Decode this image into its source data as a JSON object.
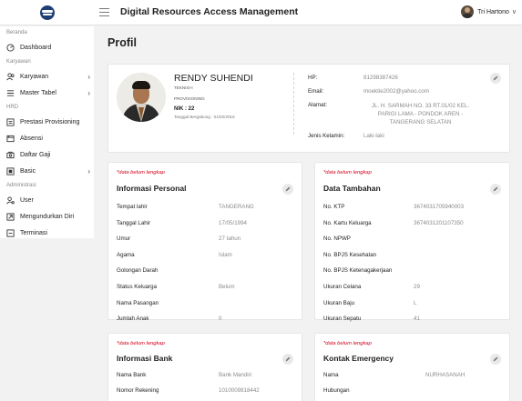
{
  "app": {
    "title": "Digital Resources Access Management"
  },
  "user": {
    "name": "Tri Hartono"
  },
  "sidebar": {
    "sections": [
      {
        "label": "Beranda"
      },
      {
        "label": "Karyawan"
      },
      {
        "label": "HRD"
      },
      {
        "label": "Administrasi"
      }
    ],
    "items": [
      {
        "label": "Dashboard",
        "icon": "dashboard-icon"
      },
      {
        "label": "Karyawan",
        "icon": "people-icon",
        "chevron": "›"
      },
      {
        "label": "Master Tabel",
        "icon": "table-icon",
        "chevron": "›"
      },
      {
        "label": "Prestasi Provisioning",
        "icon": "document-icon"
      },
      {
        "label": "Absensi",
        "icon": "absence-icon"
      },
      {
        "label": "Daftar Gaji",
        "icon": "salary-icon"
      },
      {
        "label": "Basic",
        "icon": "basic-icon",
        "chevron": "›"
      },
      {
        "label": "User",
        "icon": "user-gear-icon"
      },
      {
        "label": "Mengundurkan Diri",
        "icon": "resign-icon"
      },
      {
        "label": "Terminasi",
        "icon": "terminate-icon"
      }
    ]
  },
  "page": {
    "title": "Profil"
  },
  "profile": {
    "name": "RENDY SUHENDI",
    "role": "TEKNISI-I",
    "department": "PROVISIONING",
    "nik": "NIK : 22",
    "joined": "Tanggal Bergabung : 01/02/2016",
    "contact": [
      {
        "label": "HP:",
        "value": "81298387426"
      },
      {
        "label": "Email:",
        "value": "moektie2002@yahoo.com"
      },
      {
        "label": "Alamat:",
        "value": "JL. H. SARMAH NO. 33 RT.01/02 KEL. PARIGI LAMA - PONDOK AREN - TANGERANG SELATAN"
      },
      {
        "label": "Jenis Kelamin:",
        "value": "Laki-laki"
      }
    ]
  },
  "cards": {
    "incomplete_note": "*data belum lengkap",
    "personal": {
      "title": "Informasi Personal",
      "rows": [
        {
          "label": "Tempat lahir",
          "value": "TANGERANG"
        },
        {
          "label": "Tanggal Lahir",
          "value": "17/05/1994"
        },
        {
          "label": "Umur",
          "value": "27 tahun"
        },
        {
          "label": "Agama",
          "value": "Islam"
        },
        {
          "label": "Golongan Darah",
          "value": ""
        },
        {
          "label": "Status Keluarga",
          "value": "Belum"
        },
        {
          "label": "Nama Pasangan",
          "value": ""
        },
        {
          "label": "Jumlah Anak",
          "value": "0"
        }
      ]
    },
    "additional": {
      "title": "Data Tambahan",
      "rows": [
        {
          "label": "No. KTP",
          "value": "3674031705940003"
        },
        {
          "label": "No. Kartu Keluarga",
          "value": "3674031201107350"
        },
        {
          "label": "No. NPWP",
          "value": ""
        },
        {
          "label": "No. BPJS Kesehatan",
          "value": ""
        },
        {
          "label": "No. BPJS Ketenagakerjaan",
          "value": ""
        },
        {
          "label": "Ukuran Celana",
          "value": "29"
        },
        {
          "label": "Ukuran Baju",
          "value": "L"
        },
        {
          "label": "Ukuran Sepatu",
          "value": "41"
        }
      ]
    },
    "bank": {
      "title": "Informasi Bank",
      "rows": [
        {
          "label": "Nama Bank",
          "value": "Bank Mandiri"
        },
        {
          "label": "Nomor Rekening",
          "value": "1010009818442"
        }
      ]
    },
    "emergency": {
      "title": "Kontak Emergency",
      "rows": [
        {
          "label": "Nama",
          "value": "NURHASANAH"
        },
        {
          "label": "Hubungan",
          "value": ""
        }
      ]
    }
  }
}
